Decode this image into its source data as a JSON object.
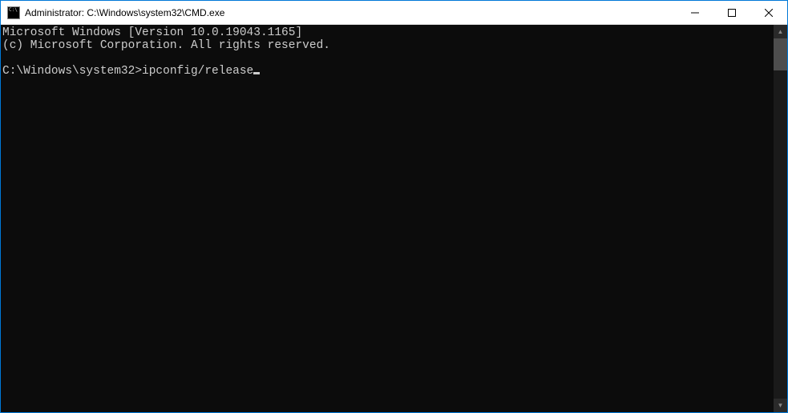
{
  "titlebar": {
    "title": "Administrator: C:\\Windows\\system32\\CMD.exe"
  },
  "console": {
    "line1": "Microsoft Windows [Version 10.0.19043.1165]",
    "line2": "(c) Microsoft Corporation. All rights reserved.",
    "blank": "",
    "prompt": "C:\\Windows\\system32>",
    "command": "ipconfig/release"
  }
}
